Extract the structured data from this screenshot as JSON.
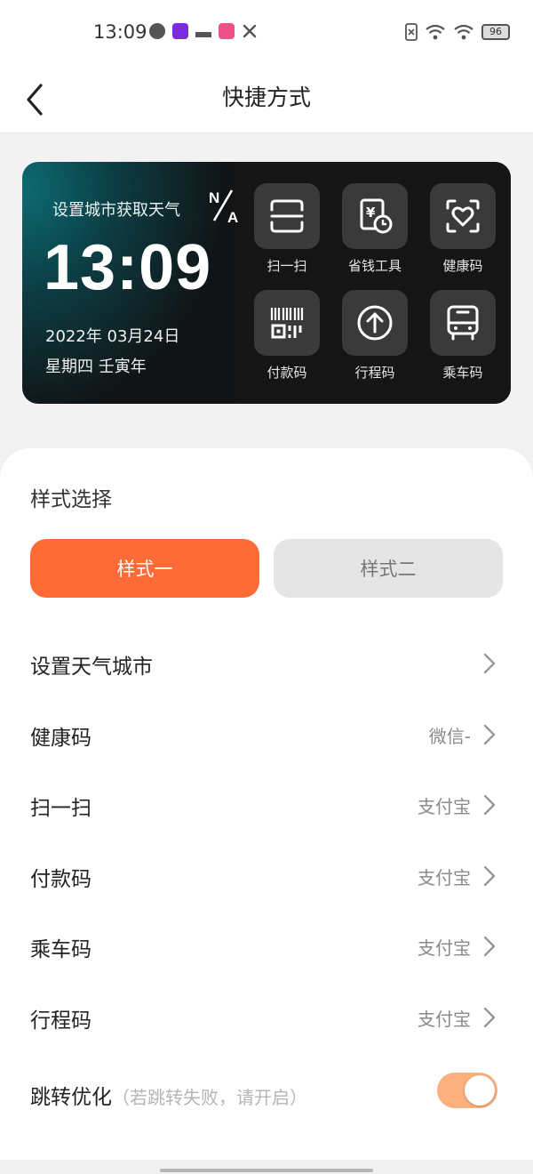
{
  "status_bar": {
    "time": "13:09",
    "battery": "96",
    "icons": [
      "q-app-icon",
      "video-app-icon",
      "bird-app-icon",
      "pink-app-icon",
      "tools-icon",
      "sim-x-icon",
      "wifi-plus-icon",
      "wifi-icon"
    ]
  },
  "header": {
    "title": "快捷方式",
    "back_icon": "chevron-left-icon"
  },
  "widget": {
    "weather_prompt": "设置城市获取天气",
    "weather_value": "N/A",
    "time": "13:09",
    "date": "2022年 03月24日",
    "weekday": "星期四 壬寅年",
    "shortcuts": [
      {
        "label": "扫一扫",
        "icon": "scan-icon"
      },
      {
        "label": "省钱工具",
        "icon": "savings-tool-icon"
      },
      {
        "label": "健康码",
        "icon": "health-code-icon"
      },
      {
        "label": "付款码",
        "icon": "payment-code-icon"
      },
      {
        "label": "行程码",
        "icon": "itinerary-code-icon"
      },
      {
        "label": "乘车码",
        "icon": "bus-code-icon"
      }
    ]
  },
  "style_select": {
    "title": "样式选择",
    "option_one": "样式一",
    "option_two": "样式二",
    "selected": "样式一"
  },
  "settings": {
    "weather_city": {
      "label": "设置天气城市"
    },
    "health_code": {
      "label": "健康码",
      "value": "微信-"
    },
    "scan": {
      "label": "扫一扫",
      "value": "支付宝"
    },
    "payment_code": {
      "label": "付款码",
      "value": "支付宝"
    },
    "bus_code": {
      "label": "乘车码",
      "value": "支付宝"
    },
    "itinerary_code": {
      "label": "行程码",
      "value": "支付宝"
    },
    "jump_optimize": {
      "label": "跳转优化",
      "hint": "（若跳转失败，请开启）",
      "enabled": true
    }
  },
  "colors": {
    "accent": "#fe6b36",
    "toggle_on": "#fdb07e"
  }
}
